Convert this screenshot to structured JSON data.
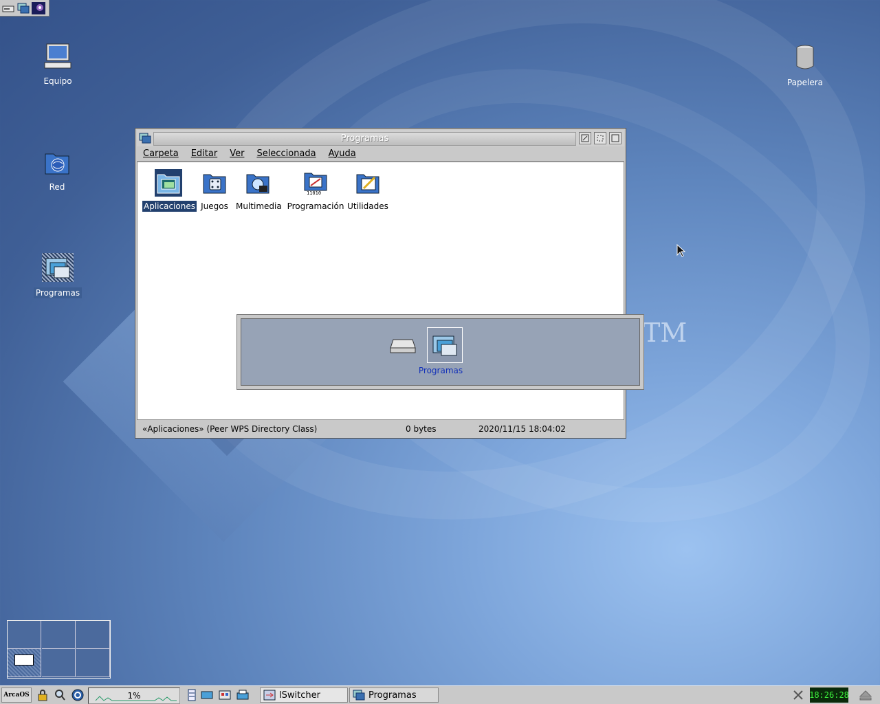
{
  "desktop": {
    "watermark": "TM",
    "icons": {
      "equipo": "Equipo",
      "red": "Red",
      "programas": "Programas",
      "papelera": "Papelera"
    }
  },
  "window": {
    "title": "Programas",
    "menu": [
      "Carpeta",
      "Editar",
      "Ver",
      "Seleccionada",
      "Ayuda"
    ],
    "items": [
      "Aplicaciones",
      "Juegos",
      "Multimedia",
      "Programación",
      "Utilidades"
    ],
    "selected_item": "Aplicaciones",
    "status": {
      "object": "«Aplicaciones» (Peer WPS Directory Class)",
      "size": "0 bytes",
      "date": "2020/11/15 18:04:02"
    }
  },
  "switcher": {
    "current_label": "Programas"
  },
  "taskbar": {
    "start_label": "ArcaOS",
    "cpu_load": "1%",
    "tasks": [
      "lSwitcher",
      "Programas"
    ],
    "clock": "18:26:28"
  },
  "colors": {
    "selection": "#22406e",
    "clock_text": "#3cf03c",
    "desktop_base": "#4a6ca4"
  }
}
